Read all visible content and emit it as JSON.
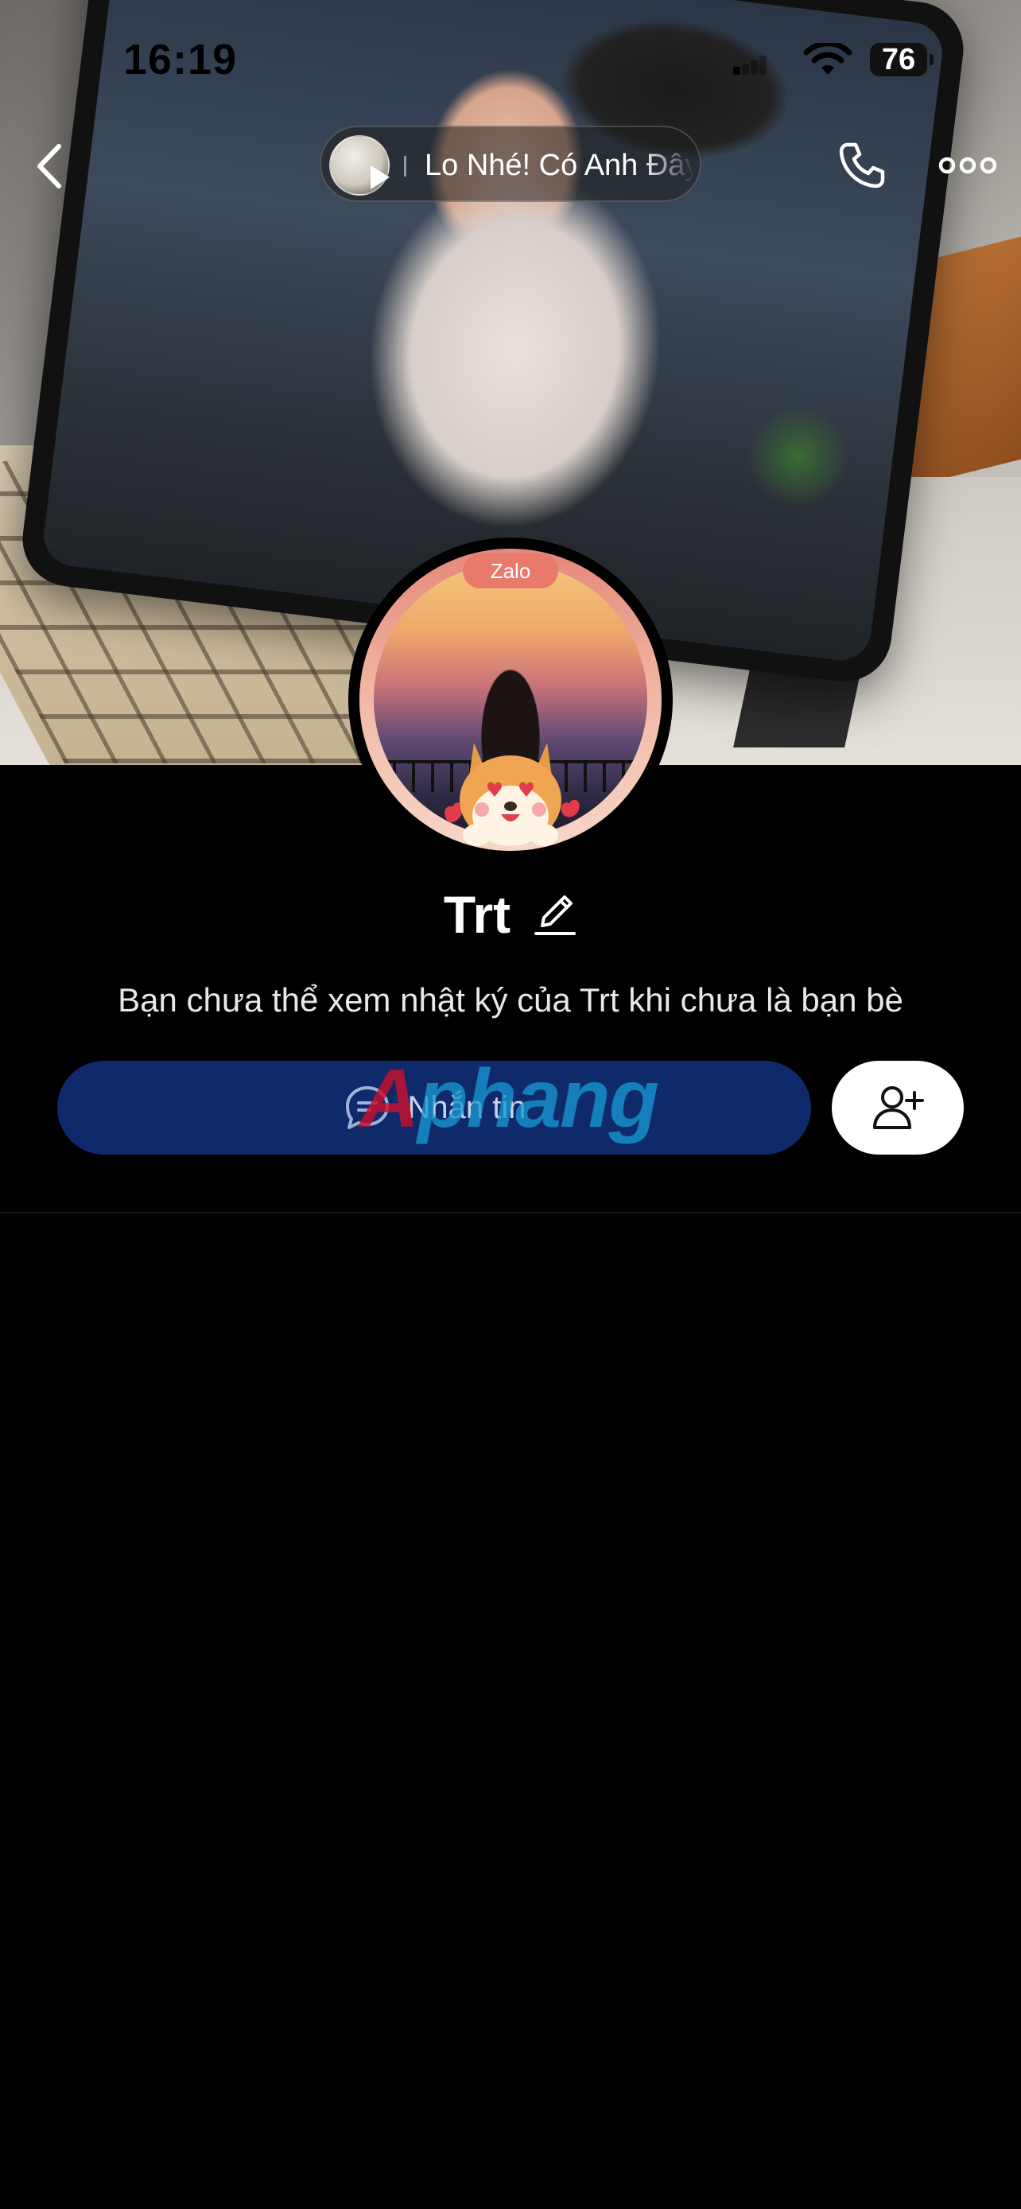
{
  "status_bar": {
    "time": "16:19",
    "battery": "76"
  },
  "nav": {
    "back_icon": "chevron-left-icon",
    "call_icon": "phone-icon",
    "more_icon": "more-dots-icon"
  },
  "music": {
    "title": "Lo Nhé! Có Anh Đây"
  },
  "avatar": {
    "tag": "Zalo"
  },
  "profile": {
    "name": "Trt",
    "notice": "Bạn chưa thể xem nhật ký của Trt khi chưa là bạn bè"
  },
  "actions": {
    "message_label": "Nhắn tin",
    "message_icon": "chat-bubble-icon",
    "add_friend_icon": "add-user-icon"
  },
  "watermark": {
    "first": "A",
    "rest": "phang"
  },
  "colors": {
    "background": "#000000",
    "message_button": "#0f2a6b",
    "add_friend_button": "#ffffff",
    "avatar_ring": "#e77a6b"
  }
}
